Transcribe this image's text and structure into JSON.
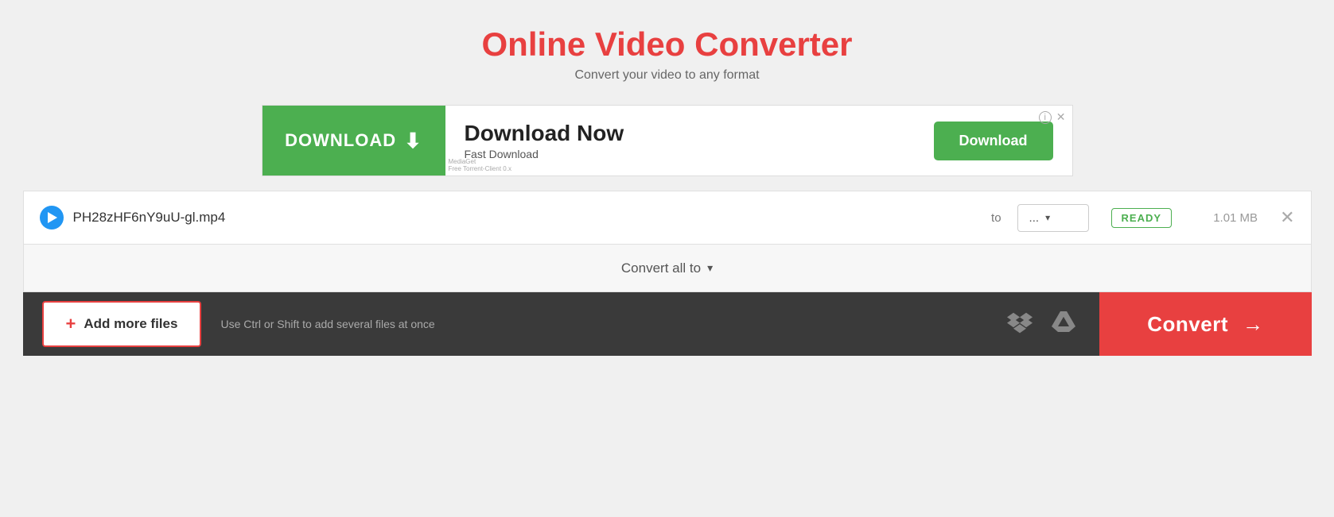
{
  "header": {
    "title": "Online Video Converter",
    "subtitle": "Convert your video to any format"
  },
  "ad": {
    "left_label": "DOWNLOAD",
    "main_title": "Download Now",
    "sub_title": "Fast Download",
    "button_label": "Download",
    "small_text": "MediaGet\nFree Torrent-Client 0.x"
  },
  "file_row": {
    "filename": "PH28zHF6nY9uU-gl.mp4",
    "to_label": "to",
    "format_value": "...",
    "status": "READY",
    "file_size": "1.01 MB"
  },
  "convert_all": {
    "label": "Convert all to"
  },
  "bottom_bar": {
    "add_files_label": "Add more files",
    "hint_text": "Use Ctrl or Shift to add several files at once",
    "convert_label": "Convert"
  }
}
